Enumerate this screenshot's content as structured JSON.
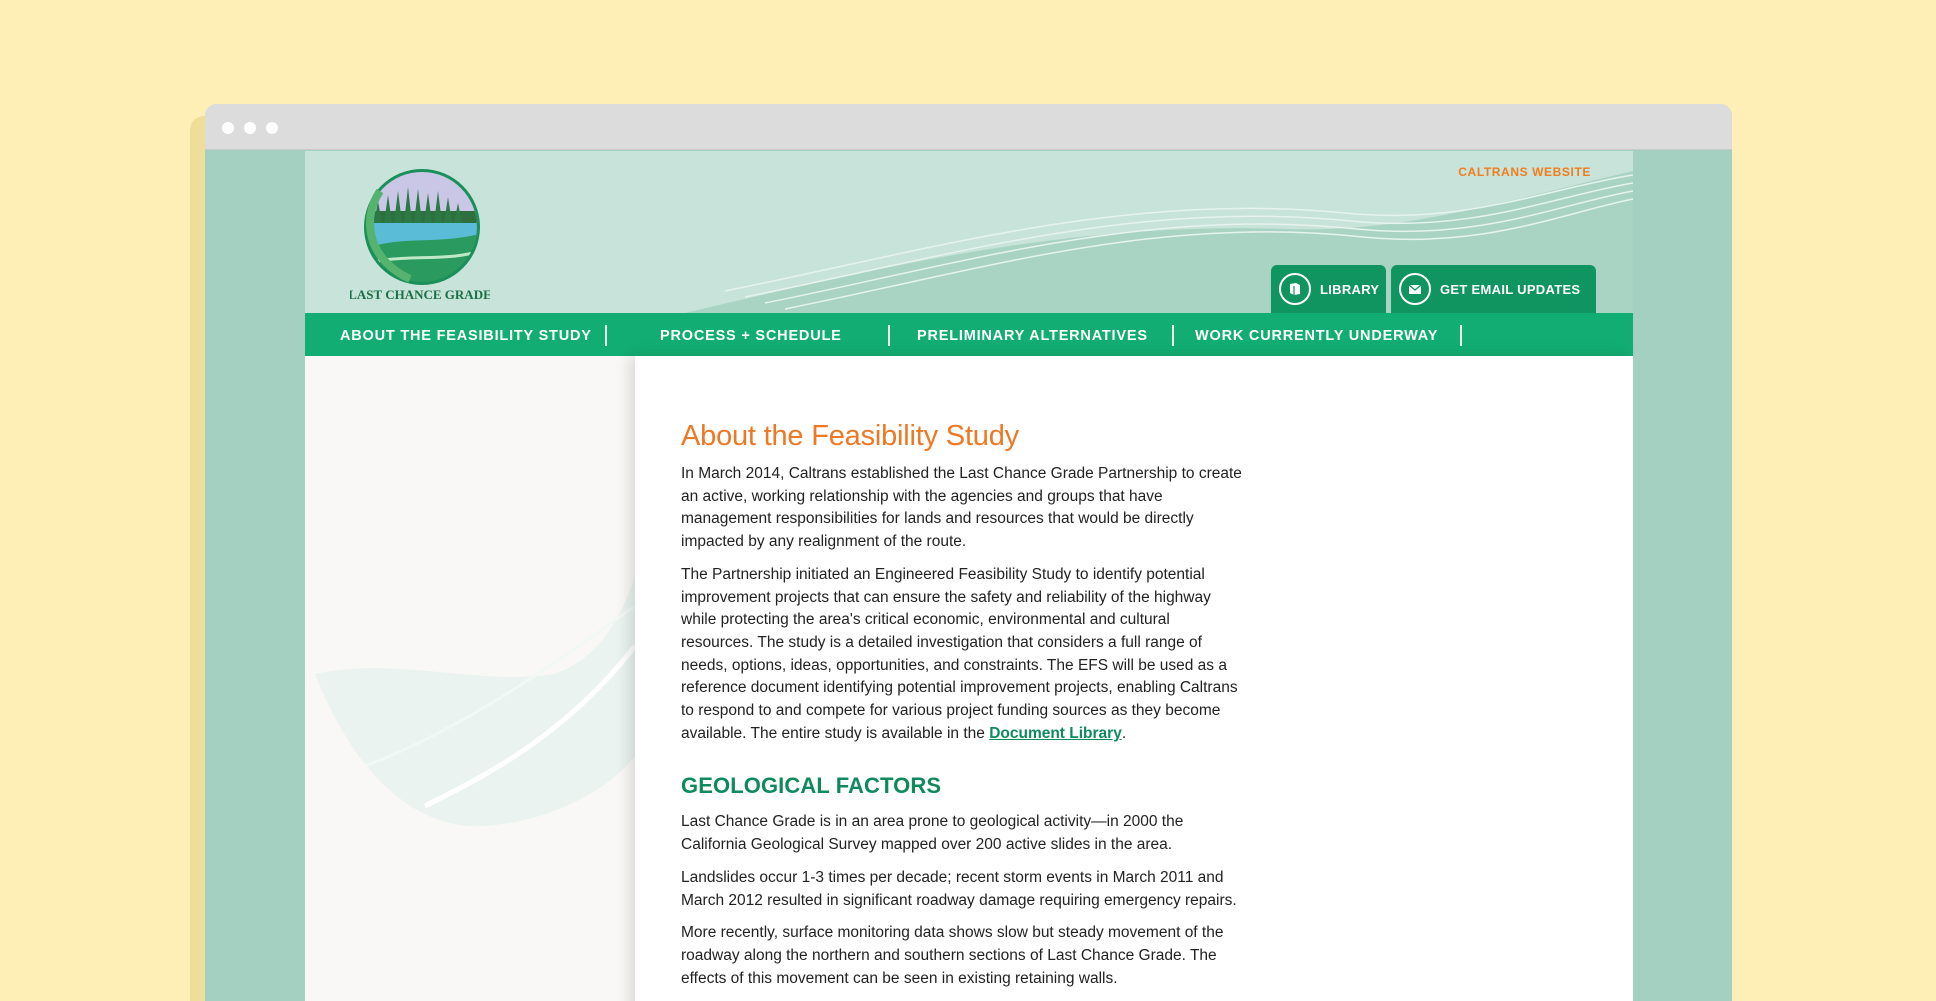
{
  "header": {
    "logo_text": "LAST CHANCE GRADE",
    "top_link": "CALTRANS WEBSITE",
    "tabs": [
      {
        "label": "LIBRARY",
        "icon": "book-icon"
      },
      {
        "label": "GET EMAIL UPDATES",
        "icon": "envelope-icon"
      }
    ]
  },
  "nav": {
    "items": [
      {
        "label": "ABOUT THE FEASIBILITY STUDY"
      },
      {
        "label": "PROCESS + SCHEDULE"
      },
      {
        "label": "PRELIMINARY ALTERNATIVES"
      },
      {
        "label": "WORK CURRENTLY UNDERWAY"
      }
    ]
  },
  "main": {
    "title": "About the Feasibility Study",
    "p1": "In March 2014, Caltrans established the Last Chance Grade Partnership to create an active, working relationship with the agencies and groups that have management responsibilities for lands and resources that would be directly impacted by any realignment of the route.",
    "p2_text": "The Partnership initiated an Engineered Feasibility Study to identify potential improvement projects that can ensure the safety and reliability of the highway while protecting the area's critical economic, environmental and cultural resources. The study is a detailed investigation that considers a full range of needs, options, ideas, opportunities, and constraints. The EFS will be used as a reference document identifying potential improvement projects, enabling Caltrans to respond to and compete for various project funding sources as they become available. The entire study is available in the ",
    "p2_link": "Document Library",
    "p2_end": ".",
    "section_heading": "GEOLOGICAL FACTORS",
    "p3": "Last Chance Grade is in an area prone to geological activity—in 2000 the California Geological Survey mapped over 200 active slides in the area.",
    "p4": "Landslides occur 1-3 times per decade; recent storm events in March 2011 and March 2012 resulted in significant roadway damage requiring emergency repairs.",
    "p5": "More recently, surface monitoring data shows slow but steady movement of the roadway along the northern and southern sections of Last Chance Grade. The effects of this movement can be seen in existing retaining walls."
  },
  "colors": {
    "accent_orange": "#ee7823",
    "brand_green": "#12ad73",
    "heading_green": "#0f8a5d",
    "header_mint": "#c8e3d9"
  }
}
